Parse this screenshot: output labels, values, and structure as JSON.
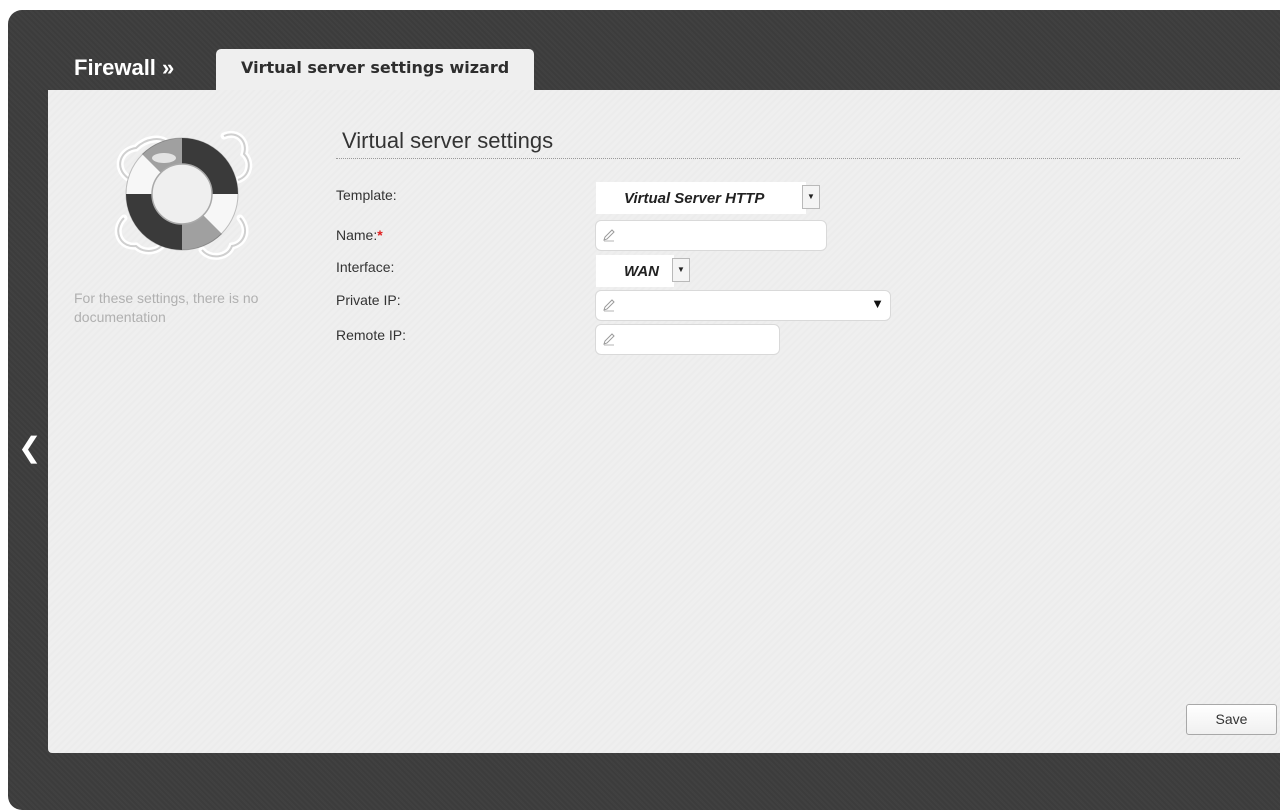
{
  "header": {
    "breadcrumb_root": "Firewall »",
    "active_tab": "Virtual server settings wizard"
  },
  "sidebar": {
    "doc_note": "For these settings, there is no documentation",
    "help_icon": "lifebuoy-icon",
    "back_icon": "chevron-left-icon"
  },
  "form": {
    "title": "Virtual server settings",
    "fields": {
      "template": {
        "label": "Template:",
        "value": "Virtual Server HTTP"
      },
      "name": {
        "label": "Name:",
        "required_mark": "*",
        "value": ""
      },
      "interface": {
        "label": "Interface:",
        "value": "WAN"
      },
      "private_ip": {
        "label": "Private IP:",
        "value": ""
      },
      "remote_ip": {
        "label": "Remote IP:",
        "value": ""
      }
    }
  },
  "footer": {
    "save_label": "Save"
  },
  "colors": {
    "frame": "#3c3c3c",
    "panel": "#efefef",
    "required": "#e02020",
    "doc_note_text": "#b0b0b0"
  }
}
